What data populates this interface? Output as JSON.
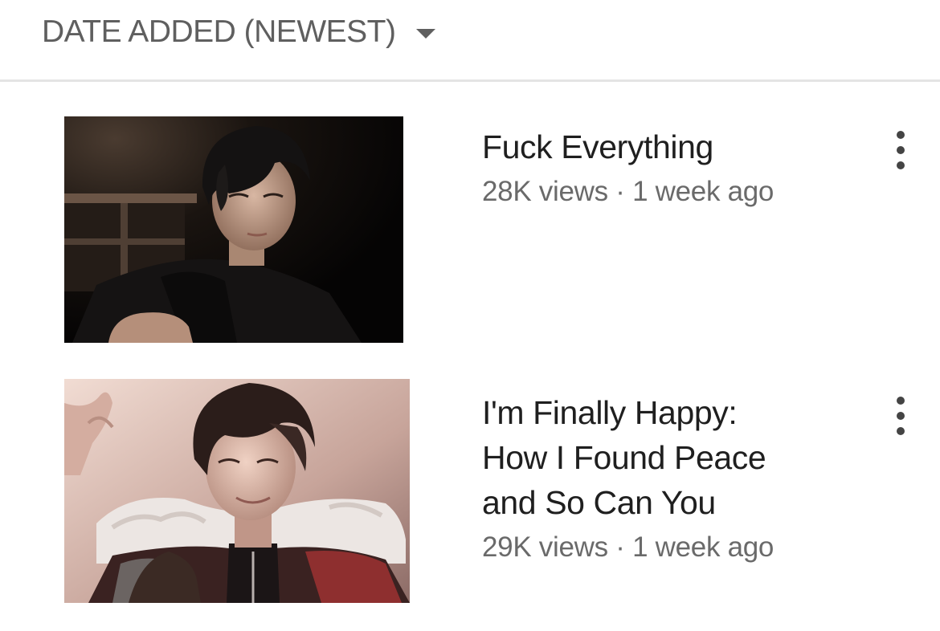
{
  "sort": {
    "label": "DATE ADDED (NEWEST)",
    "icon": "dropdown-caret-icon"
  },
  "videos": [
    {
      "title_lines": [
        "Fuck Everything"
      ],
      "views": "28K views",
      "separator": "·",
      "age": "1 week ago",
      "menu_icon": "more-vert-icon",
      "thumbnail": "dark-haired man in black jacket, dark background"
    },
    {
      "title_lines": [
        "I'm Finally Happy:",
        "How I Found Peace",
        "and So Can You"
      ],
      "views": "29K views",
      "separator": "·",
      "age": "1 week ago",
      "menu_icon": "more-vert-icon",
      "thumbnail": "smiling man in fur-collared red jacket, warm background"
    }
  ],
  "colors": {
    "sort_text": "#5f5f5f",
    "title_text": "#1f1f1f",
    "meta_text": "#6a6a6a",
    "divider": "#e4e4e4"
  }
}
